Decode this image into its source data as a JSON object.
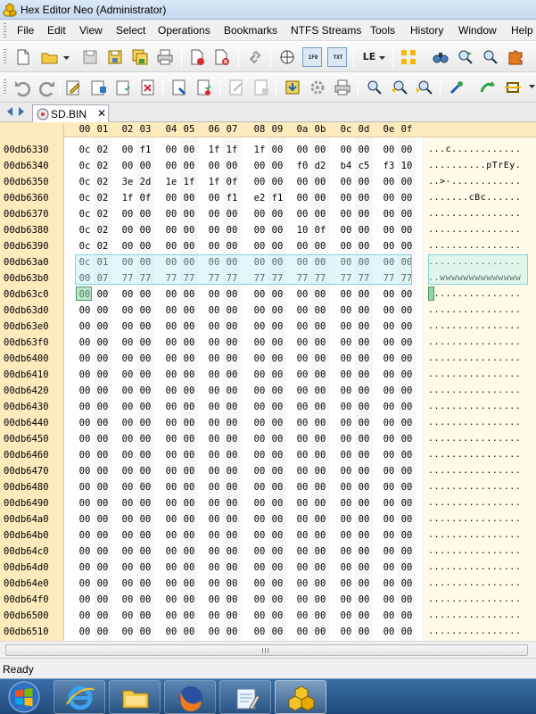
{
  "window": {
    "title": "Hex Editor Neo (Administrator)"
  },
  "menu": [
    "File",
    "Edit",
    "View",
    "Select",
    "Operations",
    "Bookmarks",
    "NTFS Streams",
    "Tools",
    "History",
    "Window",
    "Help"
  ],
  "toolbar": {
    "hex_label": "1F0",
    "txt_label": "TXT",
    "endian_label": "LE"
  },
  "tab": {
    "label": "SD.BIN",
    "close": "✕"
  },
  "editor": {
    "column_headers": [
      "00",
      "01",
      "02",
      "03",
      "04",
      "05",
      "06",
      "07",
      "08",
      "09",
      "0a",
      "0b",
      "0c",
      "0d",
      "0e",
      "0f"
    ],
    "rows": [
      {
        "offset": "00db6330",
        "bytes": [
          "0c",
          "02",
          "00",
          "f1",
          "00",
          "00",
          "1f",
          "1f",
          "1f",
          "00",
          "00",
          "00",
          "00",
          "00",
          "00",
          "00"
        ],
        "text": "...c............"
      },
      {
        "offset": "00db6340",
        "bytes": [
          "0c",
          "02",
          "00",
          "00",
          "00",
          "00",
          "00",
          "00",
          "00",
          "00",
          "f0",
          "d2",
          "b4",
          "c5",
          "f3",
          "10"
        ],
        "text": "..........pTrEy."
      },
      {
        "offset": "00db6350",
        "bytes": [
          "0c",
          "02",
          "3e",
          "2d",
          "1e",
          "1f",
          "1f",
          "0f",
          "00",
          "00",
          "00",
          "00",
          "00",
          "00",
          "00",
          "00"
        ],
        "text": "..>-............"
      },
      {
        "offset": "00db6360",
        "bytes": [
          "0c",
          "02",
          "1f",
          "0f",
          "00",
          "00",
          "00",
          "f1",
          "e2",
          "f1",
          "00",
          "00",
          "00",
          "00",
          "00",
          "00"
        ],
        "text": ".......cBc......"
      },
      {
        "offset": "00db6370",
        "bytes": [
          "0c",
          "02",
          "00",
          "00",
          "00",
          "00",
          "00",
          "00",
          "00",
          "00",
          "00",
          "00",
          "00",
          "00",
          "00",
          "00"
        ],
        "text": "................"
      },
      {
        "offset": "00db6380",
        "bytes": [
          "0c",
          "02",
          "00",
          "00",
          "00",
          "00",
          "00",
          "00",
          "00",
          "00",
          "10",
          "0f",
          "00",
          "00",
          "00",
          "00"
        ],
        "text": "................"
      },
      {
        "offset": "00db6390",
        "bytes": [
          "0c",
          "02",
          "00",
          "00",
          "00",
          "00",
          "00",
          "00",
          "00",
          "00",
          "00",
          "00",
          "00",
          "00",
          "00",
          "00"
        ],
        "text": "................"
      },
      {
        "offset": "00db63a0",
        "bytes": [
          "0c",
          "01",
          "00",
          "00",
          "00",
          "00",
          "00",
          "00",
          "00",
          "00",
          "00",
          "00",
          "00",
          "00",
          "00",
          "00"
        ],
        "text": "................"
      },
      {
        "offset": "00db63b0",
        "bytes": [
          "00",
          "07",
          "77",
          "77",
          "77",
          "77",
          "77",
          "77",
          "77",
          "77",
          "77",
          "77",
          "77",
          "77",
          "77",
          "77"
        ],
        "text": "..wwwwwwwwwwwwww"
      },
      {
        "offset": "00db63c0",
        "bytes": [
          "00",
          "00",
          "00",
          "00",
          "00",
          "00",
          "00",
          "00",
          "00",
          "00",
          "00",
          "00",
          "00",
          "00",
          "00",
          "00"
        ],
        "text": "................"
      },
      {
        "offset": "00db63d0",
        "bytes": [
          "00",
          "00",
          "00",
          "00",
          "00",
          "00",
          "00",
          "00",
          "00",
          "00",
          "00",
          "00",
          "00",
          "00",
          "00",
          "00"
        ],
        "text": "................"
      },
      {
        "offset": "00db63e0",
        "bytes": [
          "00",
          "00",
          "00",
          "00",
          "00",
          "00",
          "00",
          "00",
          "00",
          "00",
          "00",
          "00",
          "00",
          "00",
          "00",
          "00"
        ],
        "text": "................"
      },
      {
        "offset": "00db63f0",
        "bytes": [
          "00",
          "00",
          "00",
          "00",
          "00",
          "00",
          "00",
          "00",
          "00",
          "00",
          "00",
          "00",
          "00",
          "00",
          "00",
          "00"
        ],
        "text": "................"
      },
      {
        "offset": "00db6400",
        "bytes": [
          "00",
          "00",
          "00",
          "00",
          "00",
          "00",
          "00",
          "00",
          "00",
          "00",
          "00",
          "00",
          "00",
          "00",
          "00",
          "00"
        ],
        "text": "................"
      },
      {
        "offset": "00db6410",
        "bytes": [
          "00",
          "00",
          "00",
          "00",
          "00",
          "00",
          "00",
          "00",
          "00",
          "00",
          "00",
          "00",
          "00",
          "00",
          "00",
          "00"
        ],
        "text": "................"
      },
      {
        "offset": "00db6420",
        "bytes": [
          "00",
          "00",
          "00",
          "00",
          "00",
          "00",
          "00",
          "00",
          "00",
          "00",
          "00",
          "00",
          "00",
          "00",
          "00",
          "00"
        ],
        "text": "................"
      },
      {
        "offset": "00db6430",
        "bytes": [
          "00",
          "00",
          "00",
          "00",
          "00",
          "00",
          "00",
          "00",
          "00",
          "00",
          "00",
          "00",
          "00",
          "00",
          "00",
          "00"
        ],
        "text": "................"
      },
      {
        "offset": "00db6440",
        "bytes": [
          "00",
          "00",
          "00",
          "00",
          "00",
          "00",
          "00",
          "00",
          "00",
          "00",
          "00",
          "00",
          "00",
          "00",
          "00",
          "00"
        ],
        "text": "................"
      },
      {
        "offset": "00db6450",
        "bytes": [
          "00",
          "00",
          "00",
          "00",
          "00",
          "00",
          "00",
          "00",
          "00",
          "00",
          "00",
          "00",
          "00",
          "00",
          "00",
          "00"
        ],
        "text": "................"
      },
      {
        "offset": "00db6460",
        "bytes": [
          "00",
          "00",
          "00",
          "00",
          "00",
          "00",
          "00",
          "00",
          "00",
          "00",
          "00",
          "00",
          "00",
          "00",
          "00",
          "00"
        ],
        "text": "................"
      },
      {
        "offset": "00db6470",
        "bytes": [
          "00",
          "00",
          "00",
          "00",
          "00",
          "00",
          "00",
          "00",
          "00",
          "00",
          "00",
          "00",
          "00",
          "00",
          "00",
          "00"
        ],
        "text": "................"
      },
      {
        "offset": "00db6480",
        "bytes": [
          "00",
          "00",
          "00",
          "00",
          "00",
          "00",
          "00",
          "00",
          "00",
          "00",
          "00",
          "00",
          "00",
          "00",
          "00",
          "00"
        ],
        "text": "................"
      },
      {
        "offset": "00db6490",
        "bytes": [
          "00",
          "00",
          "00",
          "00",
          "00",
          "00",
          "00",
          "00",
          "00",
          "00",
          "00",
          "00",
          "00",
          "00",
          "00",
          "00"
        ],
        "text": "................"
      },
      {
        "offset": "00db64a0",
        "bytes": [
          "00",
          "00",
          "00",
          "00",
          "00",
          "00",
          "00",
          "00",
          "00",
          "00",
          "00",
          "00",
          "00",
          "00",
          "00",
          "00"
        ],
        "text": "................"
      },
      {
        "offset": "00db64b0",
        "bytes": [
          "00",
          "00",
          "00",
          "00",
          "00",
          "00",
          "00",
          "00",
          "00",
          "00",
          "00",
          "00",
          "00",
          "00",
          "00",
          "00"
        ],
        "text": "................"
      },
      {
        "offset": "00db64c0",
        "bytes": [
          "00",
          "00",
          "00",
          "00",
          "00",
          "00",
          "00",
          "00",
          "00",
          "00",
          "00",
          "00",
          "00",
          "00",
          "00",
          "00"
        ],
        "text": "................"
      },
      {
        "offset": "00db64d0",
        "bytes": [
          "00",
          "00",
          "00",
          "00",
          "00",
          "00",
          "00",
          "00",
          "00",
          "00",
          "00",
          "00",
          "00",
          "00",
          "00",
          "00"
        ],
        "text": "................"
      },
      {
        "offset": "00db64e0",
        "bytes": [
          "00",
          "00",
          "00",
          "00",
          "00",
          "00",
          "00",
          "00",
          "00",
          "00",
          "00",
          "00",
          "00",
          "00",
          "00",
          "00"
        ],
        "text": "................"
      },
      {
        "offset": "00db64f0",
        "bytes": [
          "00",
          "00",
          "00",
          "00",
          "00",
          "00",
          "00",
          "00",
          "00",
          "00",
          "00",
          "00",
          "00",
          "00",
          "00",
          "00"
        ],
        "text": "................"
      },
      {
        "offset": "00db6500",
        "bytes": [
          "00",
          "00",
          "00",
          "00",
          "00",
          "00",
          "00",
          "00",
          "00",
          "00",
          "00",
          "00",
          "00",
          "00",
          "00",
          "00"
        ],
        "text": "................"
      },
      {
        "offset": "00db6510",
        "bytes": [
          "00",
          "00",
          "00",
          "00",
          "00",
          "00",
          "00",
          "00",
          "00",
          "00",
          "00",
          "00",
          "00",
          "00",
          "00",
          "00"
        ],
        "text": "................"
      }
    ]
  },
  "status": {
    "text": "Ready"
  },
  "colors": {
    "offset_band": "#fdebbd",
    "selection": "#bee9f0",
    "caret": "#8fd6a8",
    "title_bar": "#c4d8ee",
    "taskbar": "#2b5a8e"
  },
  "taskbar": {
    "items": [
      {
        "icon": "windows-start-icon"
      },
      {
        "icon": "internet-explorer-icon"
      },
      {
        "icon": "file-explorer-icon"
      },
      {
        "icon": "firefox-icon"
      },
      {
        "icon": "notepad-icon"
      },
      {
        "icon": "hex-editor-neo-icon"
      }
    ]
  }
}
